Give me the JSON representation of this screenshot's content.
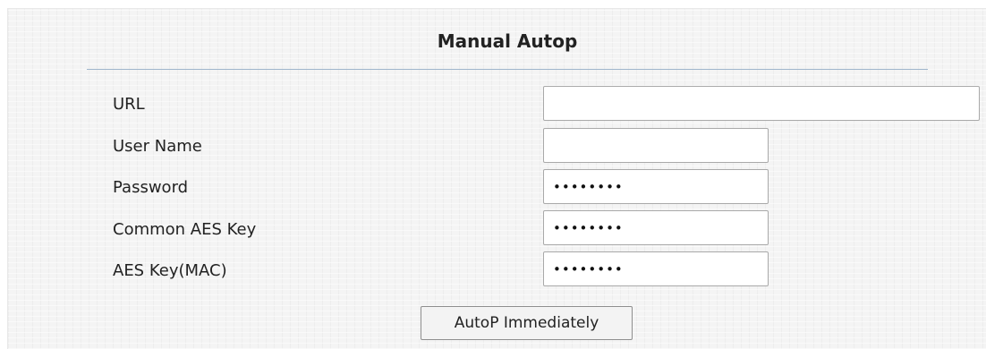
{
  "section": {
    "title": "Manual Autop"
  },
  "fields": [
    {
      "label": "URL",
      "value": "",
      "type": "text"
    },
    {
      "label": "User Name",
      "value": "",
      "type": "text"
    },
    {
      "label": "Password",
      "value": "••••••••",
      "type": "password"
    },
    {
      "label": "Common AES Key",
      "value": "••••••••",
      "type": "password"
    },
    {
      "label": "AES Key(MAC)",
      "value": "••••••••",
      "type": "password"
    }
  ],
  "actions": {
    "autop_immediately_label": "AutoP Immediately"
  },
  "colors": {
    "panel_background": "#f4f4f4",
    "title_rule": "#9fb6cc",
    "input_border": "#a9a9a9"
  }
}
